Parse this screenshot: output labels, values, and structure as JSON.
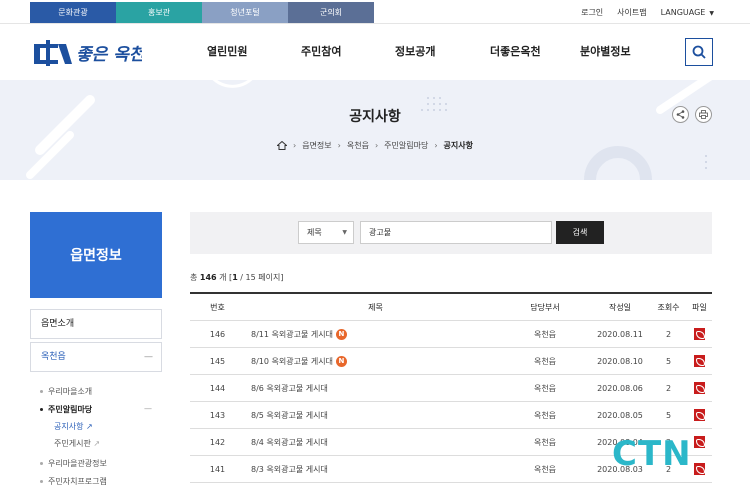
{
  "top_tabs": [
    {
      "label": "문화관광",
      "color": "#2a5aa6"
    },
    {
      "label": "홍보관",
      "color": "#2aa3a3"
    },
    {
      "label": "청년포털",
      "color": "#8aa0c4"
    },
    {
      "label": "군의회",
      "color": "#5b6f96"
    }
  ],
  "util": {
    "login": "로그인",
    "sitemap": "사이트맵",
    "language": "LANGUAGE"
  },
  "logo": {
    "text": "좋은 옥천!"
  },
  "gnb": [
    "열린민원",
    "주민참여",
    "정보공개",
    "더좋은옥천",
    "분야별정보"
  ],
  "page": {
    "title": "공지사항"
  },
  "breadcrumb": [
    "읍면정보",
    "옥천읍",
    "주민알림마당",
    "공지사항"
  ],
  "sidebar": {
    "title": "읍면정보",
    "items": [
      {
        "label": "읍면소개"
      },
      {
        "label": "옥천읍"
      }
    ],
    "subs": [
      {
        "label": "우리마을소개"
      },
      {
        "label": "주민알림마당"
      },
      {
        "label": "공지사항"
      },
      {
        "label": "주민게시판"
      },
      {
        "label": "우리마을관광정보"
      },
      {
        "label": "주민자치프로그램"
      }
    ]
  },
  "search": {
    "select_value": "제목",
    "keyword": "광고물",
    "button": "검색"
  },
  "count": {
    "prefix": "총 ",
    "total": "146",
    "mid": " 개   [",
    "page": "1",
    "suffix": " / 15 페이지]"
  },
  "table": {
    "headers": [
      "번호",
      "제목",
      "담당부서",
      "작성일",
      "조회수",
      "파일"
    ],
    "rows": [
      {
        "no": "146",
        "title": "8/11 옥외광고물 게시대",
        "new": "N",
        "dept": "옥천읍",
        "date": "2020.08.11",
        "views": "2"
      },
      {
        "no": "145",
        "title": "8/10 옥외광고물 게시대",
        "new": "N",
        "dept": "옥천읍",
        "date": "2020.08.10",
        "views": "5"
      },
      {
        "no": "144",
        "title": "8/6 옥외광고물 게시대",
        "new": "",
        "dept": "옥천읍",
        "date": "2020.08.06",
        "views": "2"
      },
      {
        "no": "143",
        "title": "8/5 옥외광고물 게시대",
        "new": "",
        "dept": "옥천읍",
        "date": "2020.08.05",
        "views": "5"
      },
      {
        "no": "142",
        "title": "8/4 옥외광고물 게시대",
        "new": "",
        "dept": "옥천읍",
        "date": "2020.08.04",
        "views": "2"
      },
      {
        "no": "141",
        "title": "8/3 옥외광고물 게시대",
        "new": "",
        "dept": "옥천읍",
        "date": "2020.08.03",
        "views": "2"
      }
    ]
  },
  "watermark": {
    "text": "CTN"
  }
}
